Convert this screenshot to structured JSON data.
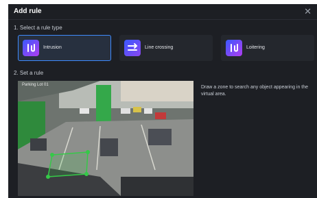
{
  "dialog": {
    "title": "Add rule",
    "close_icon": "close-icon"
  },
  "rule_type": {
    "section_title": "1. Select a rule type",
    "options": [
      {
        "label": "Intrusion",
        "icon": "intrusion-icon",
        "selected": true
      },
      {
        "label": "Line crossing",
        "icon": "line-crossing-icon",
        "selected": false
      },
      {
        "label": "Loitering",
        "icon": "loitering-icon",
        "selected": false
      }
    ]
  },
  "set_rule": {
    "section_title": "2. Set a rule",
    "camera_name": "Parking Lot 01",
    "hint": "Draw a zone to search any object appearing in the virtual area."
  },
  "colors": {
    "accent": "#3f8cff",
    "zone": "#35c948"
  }
}
